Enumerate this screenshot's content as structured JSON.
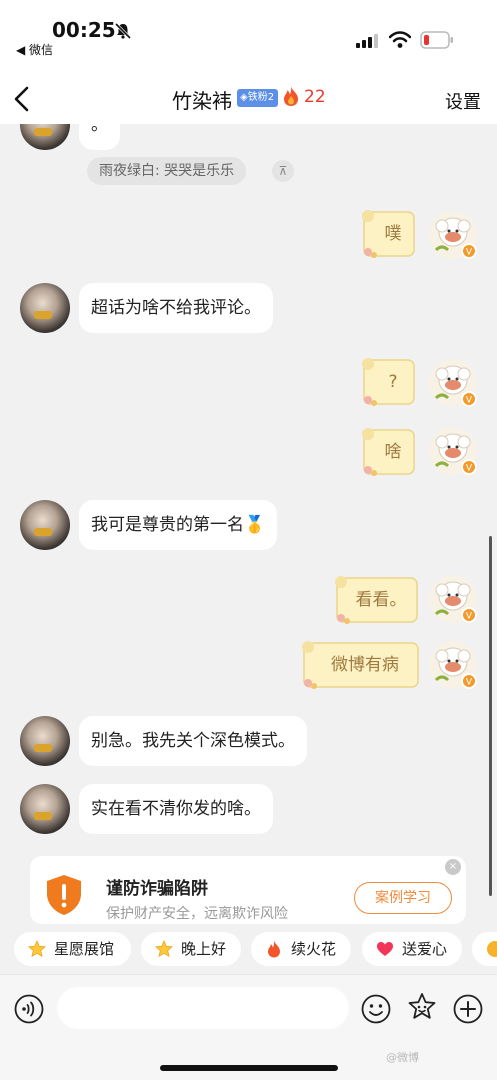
{
  "status_bar": {
    "time": "00:25",
    "back_app": "◀ 微信"
  },
  "nav": {
    "title": "竹染袆",
    "fan_badge": "◈铁粉2",
    "fire_count": "22",
    "settings": "设置"
  },
  "messages": {
    "m0_text": "。",
    "m0_quote": "雨夜绿白: 哭哭是乐乐",
    "m0_quote_close": "⊼",
    "m1_sticker": "噗",
    "m2_text": "超话为啥不给我评论。",
    "m3_sticker": "?",
    "m4_sticker": "啥",
    "m5_text": "我可是尊贵的第一名🥇",
    "m6_sticker": "看看。",
    "m7_sticker": "微博有病",
    "m8_text": "别急。我先关个深色模式。",
    "m9_text": "实在看不清你发的啥。"
  },
  "warning": {
    "title": "谨防诈骗陷阱",
    "subtitle": "保护财产安全，远离欺诈风险",
    "button": "案例学习",
    "close": "×"
  },
  "chips": [
    "星愿展馆",
    "晚上好",
    "续火花",
    "送爱心"
  ],
  "input": {
    "placeholder": ""
  },
  "watermark": "@微博"
}
